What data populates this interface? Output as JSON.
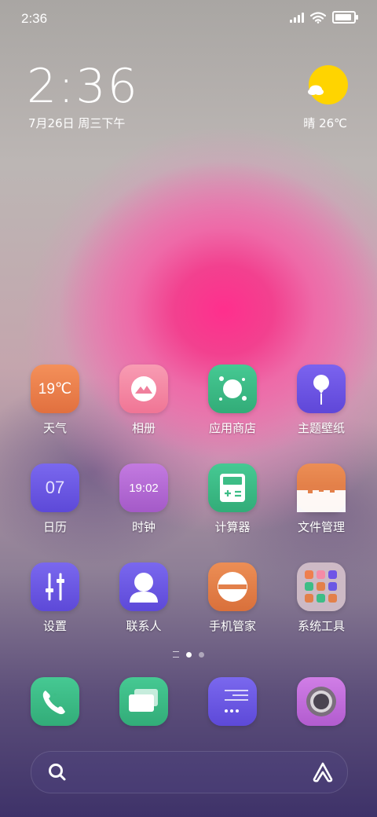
{
  "status": {
    "time": "2:36",
    "battery_percent": 90
  },
  "clock": {
    "time": "2:36",
    "date": "7月26日 周三下午"
  },
  "weather": {
    "text": "晴 26℃",
    "icon": "sun-cloud-icon"
  },
  "apps": {
    "row1": [
      {
        "label": "天气",
        "icon_text": "19℃",
        "color": "#ee7f4e"
      },
      {
        "label": "相册",
        "icon": "mountain-icon",
        "color": "#f58ba6"
      },
      {
        "label": "应用商店",
        "icon": "planet-icon",
        "color": "#3dbd86"
      },
      {
        "label": "主题壁纸",
        "icon": "balloon-icon",
        "color": "#6f55e6"
      }
    ],
    "row2": [
      {
        "label": "日历",
        "icon_text": "07",
        "color": "#6a58e4"
      },
      {
        "label": "时钟",
        "icon_text": "19:02",
        "color": "#b66ad6"
      },
      {
        "label": "计算器",
        "icon": "calculator-icon",
        "color": "#3dbd86"
      },
      {
        "label": "文件管理",
        "icon": "folder-icon",
        "color": "#e3804a"
      }
    ],
    "row3": [
      {
        "label": "设置",
        "icon": "sliders-icon",
        "color": "#6a58e4"
      },
      {
        "label": "联系人",
        "icon": "person-icon",
        "color": "#6a58e4"
      },
      {
        "label": "手机管家",
        "icon": "shield-icon",
        "color": "#e3804a"
      },
      {
        "label": "系统工具",
        "icon": "folder-grid-icon",
        "color": "#d8c5cc"
      }
    ]
  },
  "dock": [
    {
      "name": "phone",
      "icon": "phone-icon",
      "color": "#3dbd86"
    },
    {
      "name": "messages",
      "icon": "message-icon",
      "color": "#3dbd86"
    },
    {
      "name": "notes",
      "icon": "notes-icon",
      "color": "#6a58e4"
    },
    {
      "name": "camera",
      "icon": "camera-icon",
      "color": "#c06ad8"
    }
  ],
  "search": {
    "icon": "search-icon",
    "assistant_icon": "assistant-icon"
  }
}
